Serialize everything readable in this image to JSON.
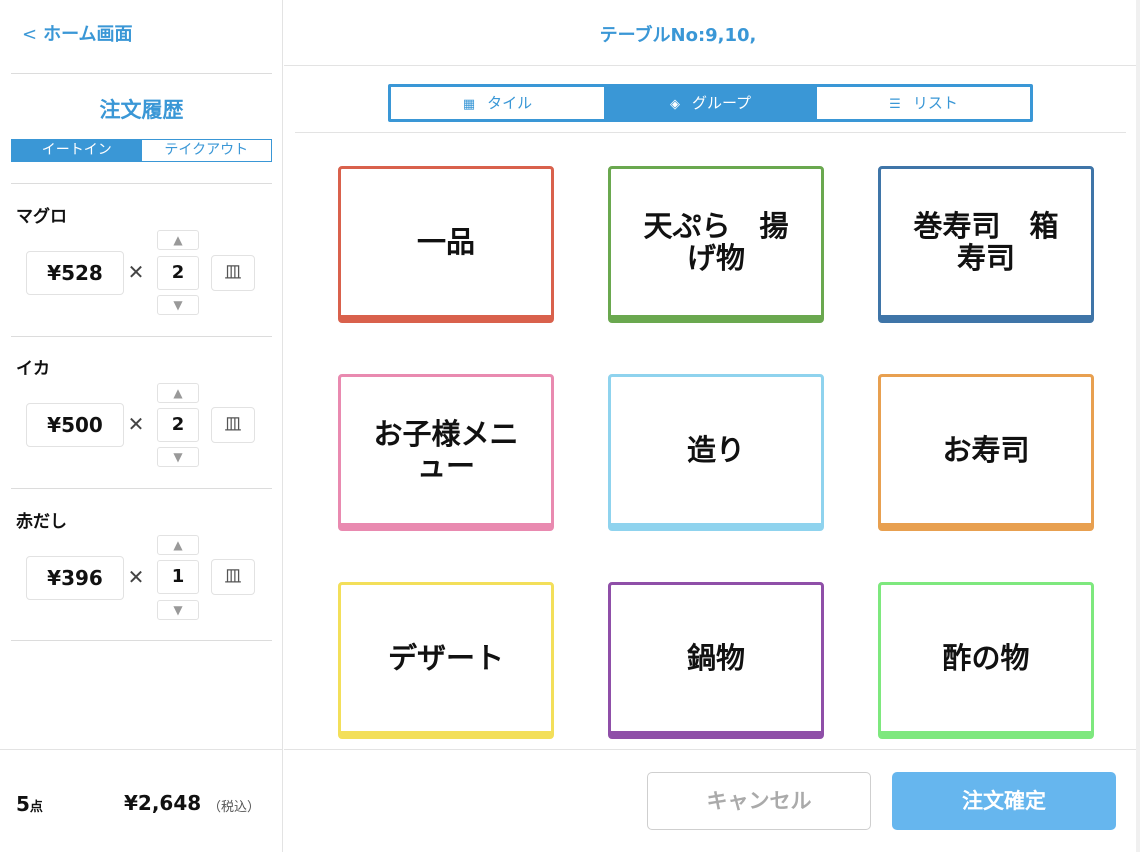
{
  "header": {
    "back_label": "ホーム画面",
    "table_no": "テーブルNo:9,10,"
  },
  "sidebar": {
    "history_title": "注文履歴",
    "segments": [
      "イートイン",
      "テイクアウト"
    ],
    "selected_segment": "イートイン",
    "items": [
      {
        "name": "マグロ",
        "price": "¥528",
        "times": "✕",
        "qty": "2"
      },
      {
        "name": "イカ",
        "price": "¥500",
        "times": "✕",
        "qty": "2"
      },
      {
        "name": "赤だし",
        "price": "¥396",
        "times": "✕",
        "qty": "1"
      }
    ],
    "step_up": "▲",
    "step_down": "▼",
    "delete_glyph": "皿",
    "summary": {
      "count": "5",
      "count_unit": "点",
      "total": "¥2,648",
      "tax_note": "（税込）"
    }
  },
  "view_tabs": [
    {
      "label": "タイル",
      "icon": "grid-icon",
      "glyph": "▦"
    },
    {
      "label": "グループ",
      "icon": "layers-icon",
      "glyph": "◈"
    },
    {
      "label": "リスト",
      "icon": "list-icon",
      "glyph": "☰"
    }
  ],
  "selected_view": "グループ",
  "groups": [
    {
      "label": "一品",
      "color": "#d9614c"
    },
    {
      "label": "天ぷら　揚げ物",
      "color": "#6aa84f"
    },
    {
      "label": "巻寿司　箱寿司",
      "color": "#3f75a8"
    },
    {
      "label": "お子様メニュー",
      "color": "#e98ab0"
    },
    {
      "label": "造り",
      "color": "#8fd3ee"
    },
    {
      "label": "お寿司",
      "color": "#e8a050"
    },
    {
      "label": "デザート",
      "color": "#f3df5a"
    },
    {
      "label": "鍋物",
      "color": "#8f4fa8"
    },
    {
      "label": "酢の物",
      "color": "#7ee87e"
    }
  ],
  "footer": {
    "cancel_label": "キャンセル",
    "confirm_label": "注文確定"
  },
  "colors": {
    "accent": "#3a97d6",
    "confirm": "#66b6ee"
  }
}
